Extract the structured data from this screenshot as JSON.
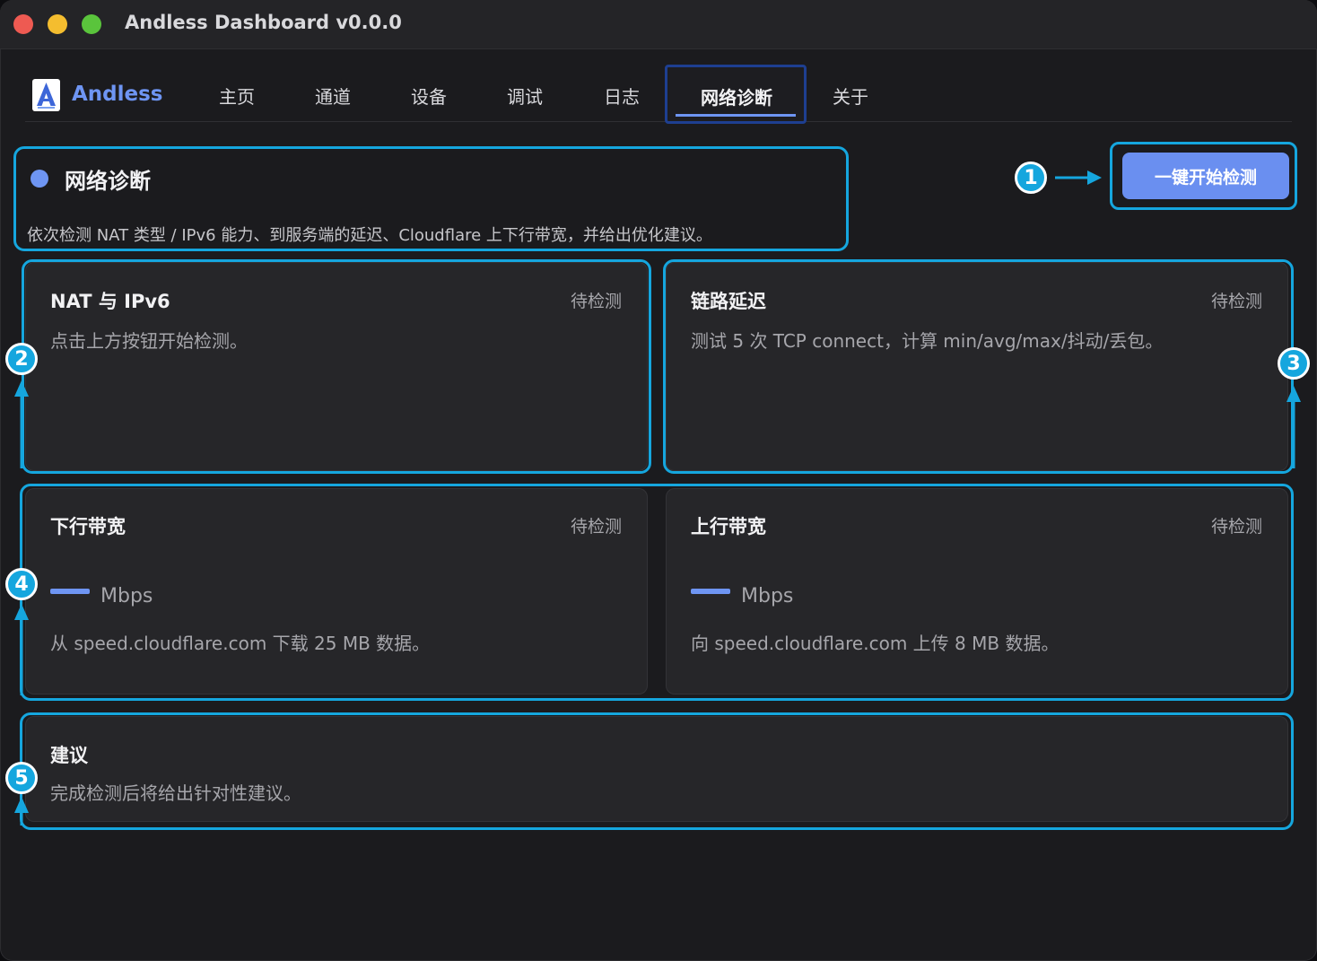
{
  "window": {
    "title": "Andless Dashboard v0.0.0"
  },
  "nav": {
    "brand": "Andless",
    "tabs": [
      {
        "label": "主页"
      },
      {
        "label": "通道"
      },
      {
        "label": "设备"
      },
      {
        "label": "调试"
      },
      {
        "label": "日志"
      },
      {
        "label": "网络诊断",
        "active": true
      },
      {
        "label": "关于"
      }
    ]
  },
  "header": {
    "title": "网络诊断",
    "description": "依次检测 NAT 类型 / IPv6 能力、到服务端的延迟、Cloudflare 上下行带宽，并给出优化建议。",
    "start_button": "一键开始检测"
  },
  "cards": {
    "nat": {
      "title": "NAT 与 IPv6",
      "status": "待检测",
      "description": "点击上方按钮开始检测。"
    },
    "latency": {
      "title": "链路延迟",
      "status": "待检测",
      "description": "测试 5 次 TCP connect，计算 min/avg/max/抖动/丢包。"
    },
    "download": {
      "title": "下行带宽",
      "status": "待检测",
      "unit": "Mbps",
      "description": "从 speed.cloudflare.com 下载 25 MB 数据。"
    },
    "upload": {
      "title": "上行带宽",
      "status": "待检测",
      "unit": "Mbps",
      "description": "向 speed.cloudflare.com 上传 8 MB 数据。"
    },
    "advice": {
      "title": "建议",
      "description": "完成检测后将给出针对性建议。"
    }
  },
  "annotations": [
    "1",
    "2",
    "3",
    "4",
    "5"
  ],
  "colors": {
    "accent": "#6e95f3",
    "highlight": "#15a6de",
    "background": "#1b1b1e",
    "card": "#262629"
  }
}
